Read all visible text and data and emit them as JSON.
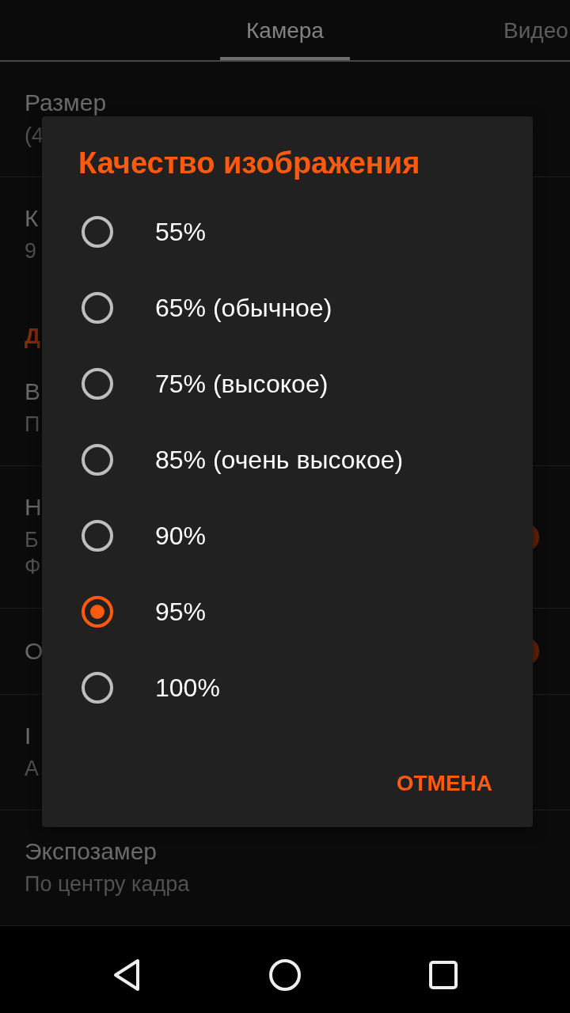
{
  "tabs": [
    {
      "label": "Камера",
      "selected": true
    },
    {
      "label": "Видео",
      "selected": false
    }
  ],
  "settings": [
    {
      "kind": "pref",
      "title": "Размер",
      "summary": [
        "(4"
      ]
    },
    {
      "kind": "pref",
      "title": "К",
      "summary": [
        "9"
      ]
    },
    {
      "kind": "header",
      "title": "Д"
    },
    {
      "kind": "pref",
      "title": "В",
      "summary": [
        "П"
      ]
    },
    {
      "kind": "pref",
      "title": "Н",
      "summary": [
        "Б",
        "Ф"
      ],
      "switch": {
        "on": true
      }
    },
    {
      "kind": "pref",
      "title": "О",
      "switch": {
        "on": true
      }
    },
    {
      "kind": "pref",
      "title": "I",
      "summary": [
        "А"
      ]
    },
    {
      "kind": "pref",
      "title": "Экспозамер",
      "summary": [
        "По центру кадра"
      ]
    }
  ],
  "dialog": {
    "title": "Качество изображения",
    "options": [
      {
        "label": "55%",
        "selected": false
      },
      {
        "label": "65% (обычное)",
        "selected": false
      },
      {
        "label": "75% (высокое)",
        "selected": false
      },
      {
        "label": "85% (очень высокое)",
        "selected": false
      },
      {
        "label": "90%",
        "selected": false
      },
      {
        "label": "95%",
        "selected": true
      },
      {
        "label": "100%",
        "selected": false
      }
    ],
    "buttons": [
      "ОТМЕНА"
    ]
  },
  "nav_bar": {
    "buttons": [
      {
        "kind": "back"
      },
      {
        "kind": "home"
      },
      {
        "kind": "recents"
      }
    ]
  }
}
